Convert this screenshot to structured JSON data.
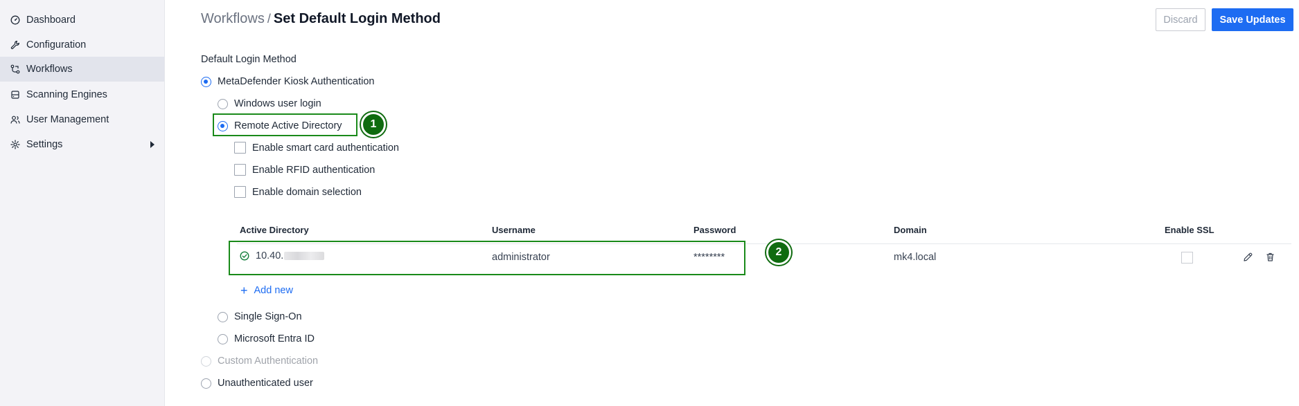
{
  "sidebar": {
    "items": [
      {
        "label": "Dashboard",
        "icon": "gauge-icon"
      },
      {
        "label": "Configuration",
        "icon": "wrench-icon"
      },
      {
        "label": "Workflows",
        "icon": "workflow-icon",
        "active": true
      },
      {
        "label": "Scanning Engines",
        "icon": "database-icon"
      },
      {
        "label": "User Management",
        "icon": "users-icon"
      },
      {
        "label": "Settings",
        "icon": "gear-icon",
        "has_submenu": true
      }
    ]
  },
  "header": {
    "breadcrumb_root": "Workflows",
    "breadcrumb_separator": "/",
    "title": "Set Default Login Method",
    "discard_label": "Discard",
    "save_label": "Save Updates"
  },
  "login": {
    "section_label": "Default Login Method",
    "options": {
      "kiosk": "MetaDefender Kiosk Authentication",
      "windows": "Windows user login",
      "remote_ad": "Remote Active Directory",
      "sso": "Single Sign-On",
      "entra": "Microsoft Entra ID",
      "custom": "Custom Authentication",
      "unauth": "Unauthenticated user"
    },
    "selected": [
      "kiosk",
      "remote_ad"
    ],
    "disabled": [
      "custom"
    ],
    "ad_checkboxes": {
      "smart_card": "Enable smart card authentication",
      "rfid": "Enable RFID authentication",
      "domain_selection": "Enable domain selection"
    }
  },
  "ad_table": {
    "headers": {
      "active_directory": "Active Directory",
      "username": "Username",
      "password": "Password",
      "domain": "Domain",
      "enable_ssl": "Enable SSL"
    },
    "rows": [
      {
        "active_directory": "10.40.",
        "username": "administrator",
        "password": "********",
        "domain": "mk4.local",
        "enable_ssl": false
      }
    ],
    "add_new_label": "Add new"
  },
  "callouts": [
    "1",
    "2"
  ],
  "colors": {
    "accent": "#1d6cf2",
    "callout_green": "#1a8a1a",
    "sidebar_bg": "#f3f3f7",
    "sidebar_active": "#e2e4ec"
  }
}
